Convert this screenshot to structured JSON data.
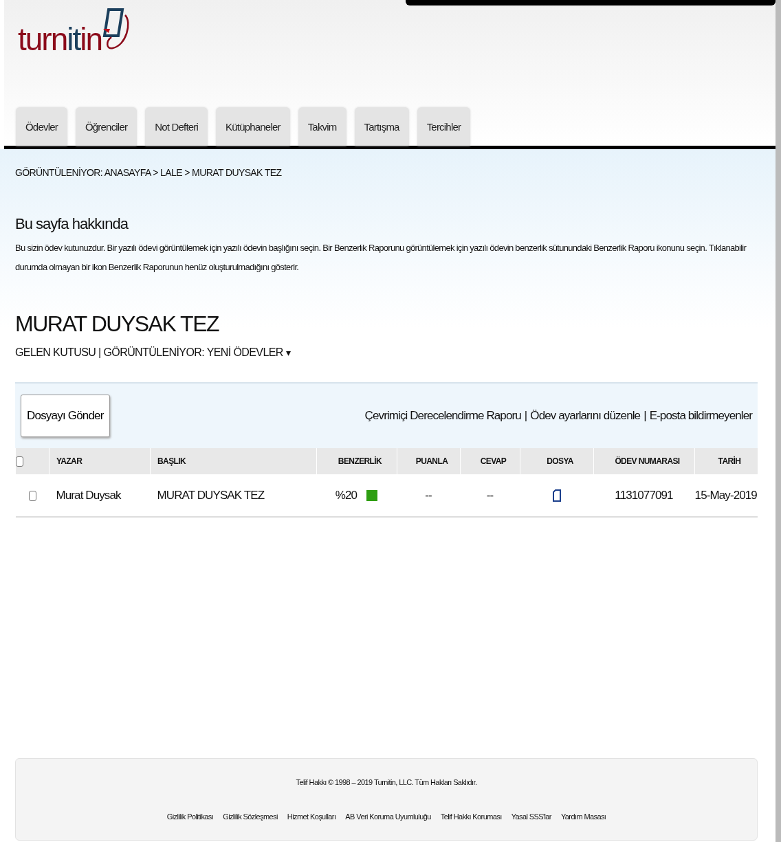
{
  "logo": {
    "parts": [
      {
        "text": "turn",
        "color": "#8b0a1a"
      },
      {
        "text": "it",
        "color": "#1b3f5c"
      },
      {
        "text": "in",
        "color": "#8b0a1a"
      }
    ]
  },
  "tabs": [
    {
      "label": "Ödevler"
    },
    {
      "label": "Öğrenciler"
    },
    {
      "label": "Not Defteri"
    },
    {
      "label": "Kütüphaneler"
    },
    {
      "label": "Takvim"
    },
    {
      "label": "Tartışma"
    },
    {
      "label": "Tercihler"
    }
  ],
  "breadcrumb": "GÖRÜNTÜLENİYOR: ANASAYFA > LALE > MURAT DUYSAK TEZ",
  "about": {
    "title": "Bu sayfa hakkında",
    "text": "Bu sizin ödev kutunuzdur. Bir yazılı ödevi görüntülemek için yazılı ödevin başlığını seçin. Bir Benzerlik Raporunu görüntülemek için yazılı ödevin benzerlik sütunundaki Benzerlik Raporu ikonunu seçin. Tıklanabilir durumda olmayan bir ikon Benzerlik Raporunun henüz oluşturulmadığını gösterir."
  },
  "assignment": {
    "title": "MURAT DUYSAK TEZ",
    "view": "GELEN KUTUSU | GÖRÜNTÜLENİYOR: YENİ ÖDEVLER",
    "caret": "▾"
  },
  "toolbar": {
    "button": "Dosyayı Gönder",
    "links": [
      "Çevrimiçi Derecelendirme Raporu",
      "Ödev ayarlarını düzenle",
      "E-posta bildirmeyenler"
    ],
    "separator": "|"
  },
  "table": {
    "select_all_checked": false,
    "columns": [
      "YAZAR",
      "BAŞLIK",
      "BENZERLİK",
      "PUANLA",
      "CEVAP",
      "DOSYA",
      "ÖDEV NUMARASI",
      "TARİH"
    ],
    "rows": [
      {
        "checked": false,
        "author": "Murat Duysak",
        "title": "MURAT DUYSAK TEZ",
        "similarity": "%20",
        "color": "#2e9e12",
        "grade": "--",
        "response": "--",
        "paper_id": "1131077091",
        "date": "15-May-2019"
      }
    ]
  },
  "footer": {
    "copyright": "Telif Hakkı © 1998 – 2019 Turnitin, LLC. Tüm Hakları Saklıdır.",
    "links": [
      "Gizlilik Politikası",
      "Gizlilik Sözleşmesi",
      "Hizmet Koşulları",
      "AB Veri Koruma Uyumluluğu",
      "Telif Hakkı Koruması",
      "Yasal SSS'lar",
      "Yardım Masası"
    ]
  }
}
